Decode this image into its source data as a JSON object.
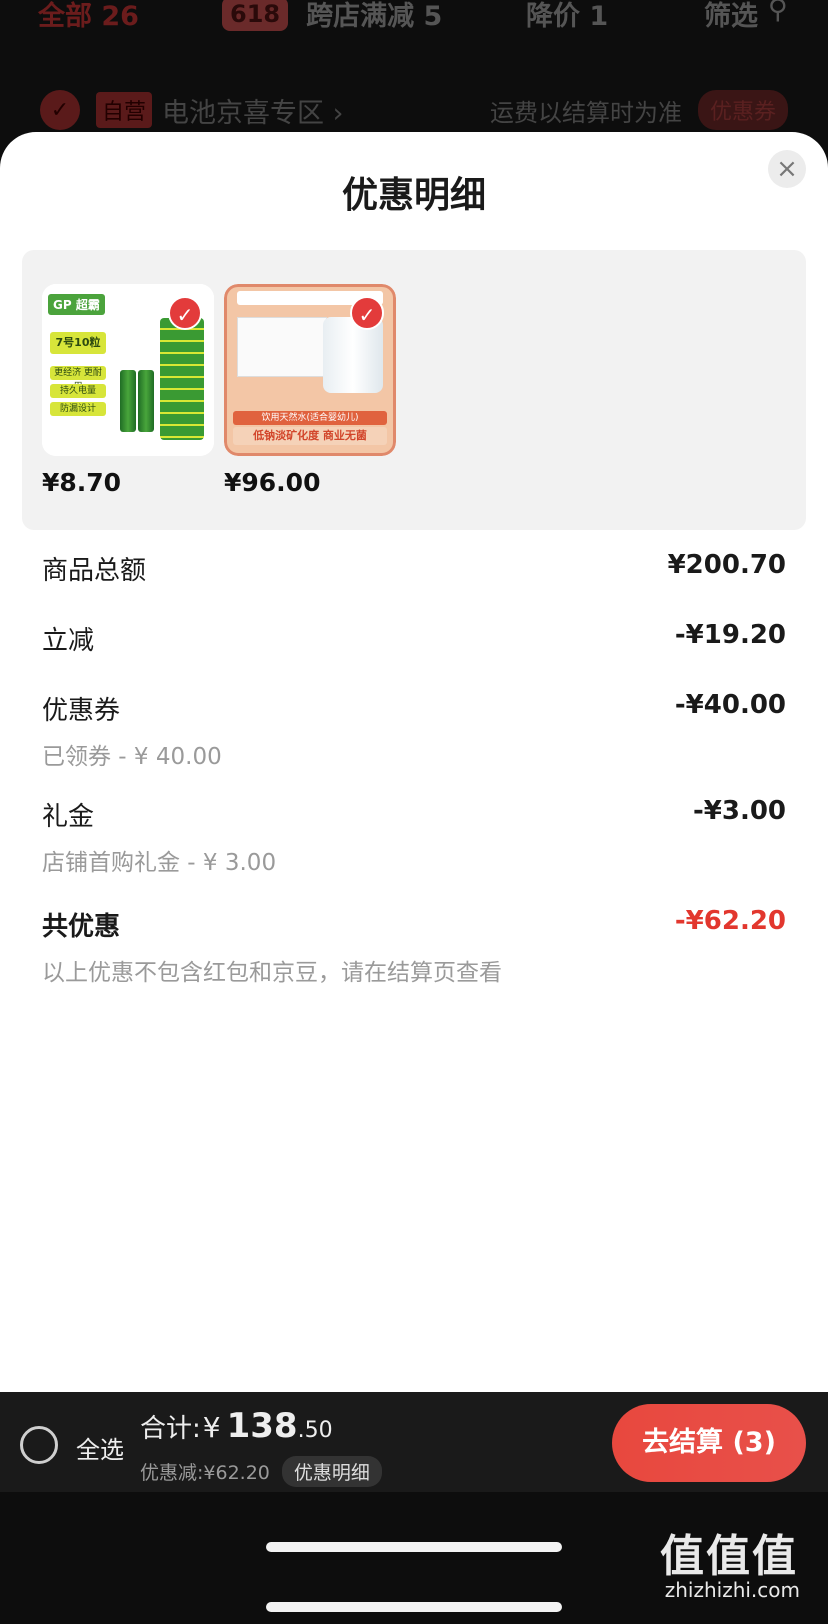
{
  "top_tabs": {
    "all": "全部 26",
    "badge_618": "618",
    "cross_store": "跨店满减 5",
    "price_drop": "降价 1",
    "filter": "筛选"
  },
  "store_row": {
    "self_tag": "自营",
    "store_name": "电池京喜专区 ›",
    "shipping_note": "运费以结算时为准",
    "coupon": "优惠券"
  },
  "sheet": {
    "title": "优惠明细",
    "close_icon": "×",
    "products": [
      {
        "price": "¥8.70",
        "art": {
          "logo": "GP 超霸",
          "box1": "7号10粒",
          "box2": "更经济 更耐用",
          "box3": "持久电量",
          "box4": "防漏设计"
        }
      },
      {
        "price": "¥96.00",
        "art": {
          "band1": "饮用天然水(适合婴幼儿)",
          "band2": "低钠淡矿化度 商业无菌"
        }
      }
    ],
    "rows": {
      "subtotal": {
        "label": "商品总额",
        "value": "¥200.70"
      },
      "instant": {
        "label": "立减",
        "value": "-¥19.20"
      },
      "coupon": {
        "label": "优惠券",
        "value": "-¥40.00",
        "sub": "已领券 - ¥ 40.00"
      },
      "gift": {
        "label": "礼金",
        "value": "-¥3.00",
        "sub": "店铺首购礼金 - ¥ 3.00"
      },
      "total": {
        "label": "共优惠",
        "value": "-¥62.20",
        "sub": "以上优惠不包含红包和京豆，请在结算页查看"
      }
    }
  },
  "bottom_bar": {
    "select_all": "全选",
    "total_label": "合计:",
    "currency": "¥",
    "total_int": "138",
    "total_dec": ".50",
    "discount_text": "优惠减:¥62.20",
    "discount_tag": "优惠明细",
    "checkout": "去结算 (3)"
  },
  "watermark": {
    "logo": "值值值",
    "url": "zhizhizhi.com"
  },
  "colors": {
    "accent": "#e2372e",
    "checkout": "#e8483e",
    "sheet_bg": "#ffffff",
    "products_bg": "#f2f2f2"
  }
}
